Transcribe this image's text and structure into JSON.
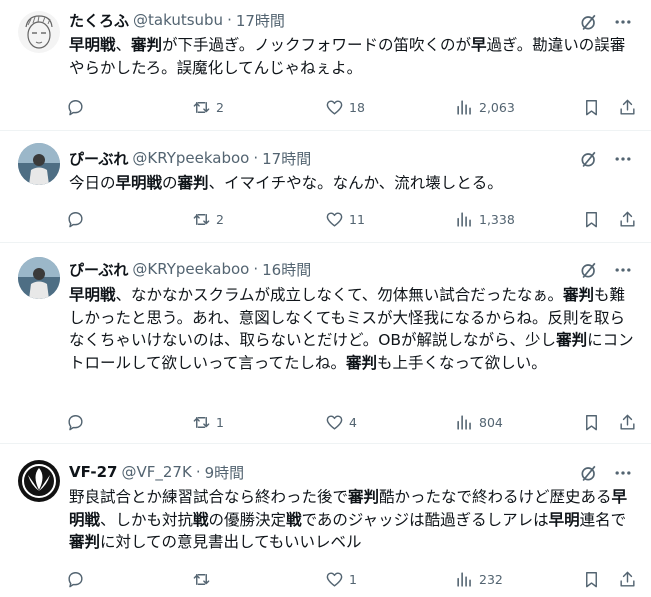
{
  "tweets": [
    {
      "author": "たくろふ",
      "handle": "@takutsubu",
      "sep": "·",
      "time": "17時間",
      "body": [
        {
          "t": "早明戦",
          "b": true
        },
        {
          "t": "、"
        },
        {
          "t": "審判",
          "b": true
        },
        {
          "t": "が下手過ぎ。ノックフォワードの笛吹くのが"
        },
        {
          "t": "早",
          "b": true
        },
        {
          "t": "過ぎ。勘違いの誤審やらかしたろ。誤魔化してんじゃねぇよ。"
        }
      ],
      "stats": {
        "replies": "",
        "reposts": "2",
        "likes": "18",
        "views": "2,063"
      }
    },
    {
      "author": "ぴーぶれ",
      "handle": "@KRYpeekaboo",
      "sep": "·",
      "time": "17時間",
      "body": [
        {
          "t": "今日の"
        },
        {
          "t": "早明戦",
          "b": true
        },
        {
          "t": "の"
        },
        {
          "t": "審判",
          "b": true
        },
        {
          "t": "、イマイチやな。なんか、流れ壊しとる。"
        }
      ],
      "stats": {
        "replies": "",
        "reposts": "2",
        "likes": "11",
        "views": "1,338"
      }
    },
    {
      "author": "ぴーぶれ",
      "handle": "@KRYpeekaboo",
      "sep": "·",
      "time": "16時間",
      "body": [
        {
          "t": "早明戦",
          "b": true
        },
        {
          "t": "、なかなかスクラムが成立しなくて、勿体無い試合だったなぁ。"
        },
        {
          "t": "審判",
          "b": true
        },
        {
          "t": "も難しかったと思う。あれ、意図しなくてもミスが大怪我になるからね。反則を取らなくちゃいけないのは、取らないとだけど。OBが解説しながら、少し"
        },
        {
          "t": "審判",
          "b": true
        },
        {
          "t": "にコントロールして欲しいって言ってたしね。"
        },
        {
          "t": "審判",
          "b": true
        },
        {
          "t": "も上手くなって欲しい。"
        }
      ],
      "stats": {
        "replies": "",
        "reposts": "1",
        "likes": "4",
        "views": "804"
      }
    },
    {
      "author": "VF-27",
      "handle": "@VF_27K",
      "sep": "·",
      "time": "9時間",
      "body": [
        {
          "t": "野良試合とか練習試合なら終わった後で"
        },
        {
          "t": "審判",
          "b": true
        },
        {
          "t": "酷かったなで終わるけど歴史ある"
        },
        {
          "t": "早明戦",
          "b": true
        },
        {
          "t": "、しかも対抗"
        },
        {
          "t": "戦",
          "b": true
        },
        {
          "t": "の優勝決定"
        },
        {
          "t": "戦",
          "b": true
        },
        {
          "t": "であのジャッジは酷過ぎるしアレは"
        },
        {
          "t": "早明",
          "b": true
        },
        {
          "t": "連名で"
        },
        {
          "t": "審判",
          "b": true
        },
        {
          "t": "に対しての意見書出してもいいレベル"
        }
      ],
      "stats": {
        "replies": "",
        "reposts": "",
        "likes": "1",
        "views": "232"
      }
    }
  ],
  "icons": {
    "grok": "grok-icon",
    "more": "more-icon",
    "reply": "reply-icon",
    "repost": "repost-icon",
    "like": "like-icon",
    "views": "views-icon",
    "bookmark": "bookmark-icon",
    "share": "share-icon"
  },
  "colors": {
    "text": "#0f1419",
    "muted": "#536471",
    "divider": "#eff3f4"
  }
}
